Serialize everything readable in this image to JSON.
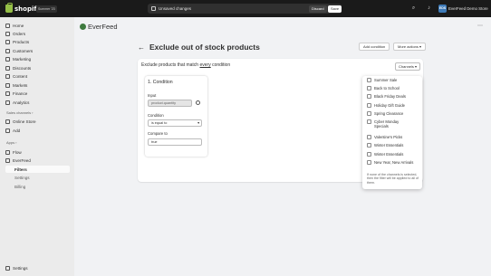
{
  "topbar": {
    "logo_text": "shopify",
    "edition_badge": "Summer '23",
    "unsaved_label": "Unsaved changes",
    "discard_label": "Discard",
    "save_label": "Save",
    "store_initials": "EDS",
    "store_name": "EverFeed Demo Store"
  },
  "sidebar": {
    "items": [
      {
        "label": "Home",
        "icon": "home-icon"
      },
      {
        "label": "Orders",
        "icon": "orders-icon"
      },
      {
        "label": "Products",
        "icon": "products-icon"
      },
      {
        "label": "Customers",
        "icon": "customers-icon"
      },
      {
        "label": "Marketing",
        "icon": "marketing-icon"
      },
      {
        "label": "Discounts",
        "icon": "discounts-icon"
      },
      {
        "label": "Content",
        "icon": "content-icon"
      },
      {
        "label": "Markets",
        "icon": "markets-icon"
      },
      {
        "label": "Finance",
        "icon": "finance-icon"
      },
      {
        "label": "Analytics",
        "icon": "analytics-icon"
      }
    ],
    "sales_channels_title": "Sales channels",
    "online_store": "Online Store",
    "add_label": "Add",
    "apps_title": "Apps",
    "flow": "Flow",
    "everfeed": "EverFeed",
    "filters": "Filters",
    "settings_sub": "Settings",
    "billing": "Billing",
    "settings": "Settings"
  },
  "app": {
    "name": "EverFeed",
    "page_title": "Exclude out of stock products",
    "add_condition": "Add condition",
    "more_actions": "More actions"
  },
  "card": {
    "title_prefix": "Exclude products that match ",
    "title_emph": "every",
    "title_suffix": " condition",
    "channels_button": "Channels"
  },
  "condition": {
    "title": "1. Condition",
    "input_label": "Input",
    "input_value": "product.quantity",
    "condition_label": "Condition",
    "condition_value": "is equal to",
    "compare_label": "Compare to",
    "compare_value": "true"
  },
  "channels": {
    "items": [
      "Summer Sale",
      "Back to School",
      "Black Friday Deals",
      "Holiday Gift Guide",
      "Spring Clearance",
      "Cyber Monday Specials",
      "Valentine's Picks",
      "Winter Essentials",
      "Winter Essentials",
      "New Year, New Arrivals"
    ],
    "hint": "If none of the channels is selected, then the filter will be applied to all of them."
  },
  "colors": {
    "topbar": "#1a1a1a",
    "sidebar": "#ebebeb",
    "background": "#f1f2f4",
    "brand_green": "#95bf47"
  }
}
